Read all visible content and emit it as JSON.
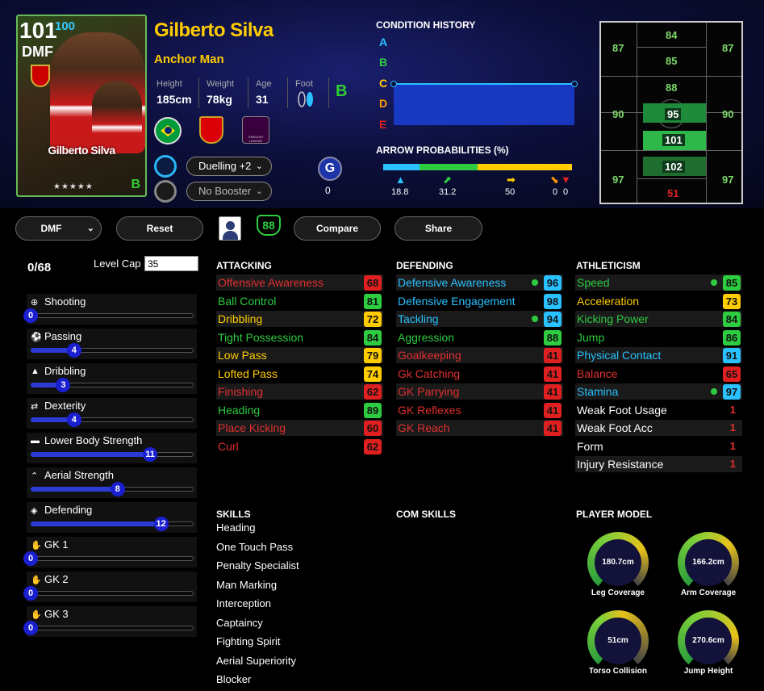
{
  "card": {
    "overall": "101",
    "overall_alt": "100",
    "position": "DMF",
    "name": "Gilberto Silva",
    "stars": "★★★★★",
    "playstyle_grade": "B"
  },
  "player": {
    "name": "Gilberto Silva",
    "role": "Anchor Man",
    "height_label": "Height",
    "height": "185cm",
    "weight_label": "Weight",
    "weight": "78kg",
    "age_label": "Age",
    "age": "31",
    "foot_label": "Foot",
    "foot_grade": "B",
    "league_text": "ENGLISH LEAGUE"
  },
  "boosters": {
    "skill_select": "Duelling +2",
    "booster_select": "No Booster",
    "g_icon": "G",
    "g_value": "0"
  },
  "condition": {
    "title": "CONDITION HISTORY",
    "letters": [
      {
        "label": "A",
        "color": "#29c1ff"
      },
      {
        "label": "B",
        "color": "#2ecc40"
      },
      {
        "label": "C",
        "color": "#ffcc00"
      },
      {
        "label": "D",
        "color": "#ff9900"
      },
      {
        "label": "E",
        "color": "#e02020"
      }
    ]
  },
  "arrows": {
    "title": "ARROW PROBABILITIES (%)",
    "values": [
      "18.8",
      "31.2",
      "50",
      "0",
      "0"
    ],
    "colors": [
      "#29c1ff",
      "#2ecc40",
      "#ffcc00",
      "#ff9900",
      "#e02020"
    ]
  },
  "pitch": {
    "numbers": [
      "84",
      "87",
      "87",
      "85",
      "88",
      "90",
      "95",
      "90",
      "101",
      "102",
      "97",
      "97",
      "51"
    ]
  },
  "toolbar": {
    "position_select": "DMF",
    "reset": "Reset",
    "ovr_badge": "88",
    "compare": "Compare",
    "share": "Share"
  },
  "progression": {
    "points": "0/68",
    "level_cap_label": "Level Cap",
    "level_cap_value": "35",
    "rows": [
      {
        "label": "Shooting",
        "value": "0",
        "level": 0
      },
      {
        "label": "Passing",
        "value": "4",
        "level": 4
      },
      {
        "label": "Dribbling",
        "value": "3",
        "level": 3
      },
      {
        "label": "Dexterity",
        "value": "4",
        "level": 4
      },
      {
        "label": "Lower Body Strength",
        "value": "11",
        "level": 11
      },
      {
        "label": "Aerial Strength",
        "value": "8",
        "level": 8
      },
      {
        "label": "Defending",
        "value": "12",
        "level": 12
      },
      {
        "label": "GK 1",
        "value": "0",
        "level": 0
      },
      {
        "label": "GK 2",
        "value": "0",
        "level": 0
      },
      {
        "label": "GK 3",
        "value": "0",
        "level": 0
      }
    ]
  },
  "attacking": {
    "title": "ATTACKING",
    "rows": [
      {
        "label": "Offensive Awareness",
        "value": "68",
        "color": "#e03030",
        "badge": "#e02020",
        "dot": false
      },
      {
        "label": "Ball Control",
        "value": "81",
        "color": "#2ecc40",
        "badge": "#2ecc40",
        "dot": false
      },
      {
        "label": "Dribbling",
        "value": "72",
        "color": "#ffcc00",
        "badge": "#ffcc00",
        "dot": false
      },
      {
        "label": "Tight Possession",
        "value": "84",
        "color": "#2ecc40",
        "badge": "#2ecc40",
        "dot": false
      },
      {
        "label": "Low Pass",
        "value": "79",
        "color": "#ffcc00",
        "badge": "#ffcc00",
        "dot": false
      },
      {
        "label": "Lofted Pass",
        "value": "74",
        "color": "#ffcc00",
        "badge": "#ffcc00",
        "dot": false
      },
      {
        "label": "Finishing",
        "value": "62",
        "color": "#e03030",
        "badge": "#e02020",
        "dot": false
      },
      {
        "label": "Heading",
        "value": "89",
        "color": "#2ecc40",
        "badge": "#2ecc40",
        "dot": false
      },
      {
        "label": "Place Kicking",
        "value": "60",
        "color": "#e03030",
        "badge": "#e02020",
        "dot": false
      },
      {
        "label": "Curl",
        "value": "62",
        "color": "#e03030",
        "badge": "#e02020",
        "dot": false
      }
    ]
  },
  "defending": {
    "title": "DEFENDING",
    "rows": [
      {
        "label": "Defensive Awareness",
        "value": "96",
        "color": "#29c1ff",
        "badge": "#29c1ff",
        "dot": true
      },
      {
        "label": "Defensive Engagement",
        "value": "98",
        "color": "#29c1ff",
        "badge": "#29c1ff",
        "dot": false
      },
      {
        "label": "Tackling",
        "value": "94",
        "color": "#29c1ff",
        "badge": "#29c1ff",
        "dot": true
      },
      {
        "label": "Aggression",
        "value": "88",
        "color": "#2ecc40",
        "badge": "#2ecc40",
        "dot": false
      },
      {
        "label": "Goalkeeping",
        "value": "41",
        "color": "#e03030",
        "badge": "#e02020",
        "dot": false
      },
      {
        "label": "Gk Catching",
        "value": "41",
        "color": "#e03030",
        "badge": "#e02020",
        "dot": false
      },
      {
        "label": "GK Parrying",
        "value": "41",
        "color": "#e03030",
        "badge": "#e02020",
        "dot": false
      },
      {
        "label": "GK Reflexes",
        "value": "41",
        "color": "#e03030",
        "badge": "#e02020",
        "dot": false
      },
      {
        "label": "GK Reach",
        "value": "41",
        "color": "#e03030",
        "badge": "#e02020",
        "dot": false
      }
    ]
  },
  "athleticism": {
    "title": "ATHLETICISM",
    "rows": [
      {
        "label": "Speed",
        "value": "85",
        "color": "#2ecc40",
        "badge": "#2ecc40",
        "dot": true
      },
      {
        "label": "Acceleration",
        "value": "73",
        "color": "#ffcc00",
        "badge": "#ffcc00",
        "dot": false
      },
      {
        "label": "Kicking Power",
        "value": "84",
        "color": "#2ecc40",
        "badge": "#2ecc40",
        "dot": false
      },
      {
        "label": "Jump",
        "value": "86",
        "color": "#2ecc40",
        "badge": "#2ecc40",
        "dot": false
      },
      {
        "label": "Physical Contact",
        "value": "91",
        "color": "#29c1ff",
        "badge": "#29c1ff",
        "dot": false
      },
      {
        "label": "Balance",
        "value": "65",
        "color": "#e03030",
        "badge": "#e02020",
        "dot": false
      },
      {
        "label": "Stamina",
        "value": "97",
        "color": "#29c1ff",
        "badge": "#29c1ff",
        "dot": true
      }
    ],
    "extra": [
      {
        "label": "Weak Foot Usage",
        "value": "1"
      },
      {
        "label": "Weak Foot Acc",
        "value": "1"
      },
      {
        "label": "Form",
        "value": "1"
      },
      {
        "label": "Injury Resistance",
        "value": "1"
      }
    ]
  },
  "skills": {
    "title": "SKILLS",
    "items": [
      "Heading",
      "One Touch Pass",
      "Penalty Specialist",
      "Man Marking",
      "Interception",
      "Captaincy",
      "Fighting Spirit",
      "Aerial Superiority",
      "Blocker"
    ]
  },
  "com_skills": {
    "title": "COM SKILLS"
  },
  "player_model": {
    "title": "PLAYER MODEL",
    "gauges": [
      {
        "label": "Leg Coverage",
        "value": "180.7cm"
      },
      {
        "label": "Arm Coverage",
        "value": "166.2cm"
      },
      {
        "label": "Torso Collision",
        "value": "51cm"
      },
      {
        "label": "Jump Height",
        "value": "270.6cm"
      }
    ]
  }
}
